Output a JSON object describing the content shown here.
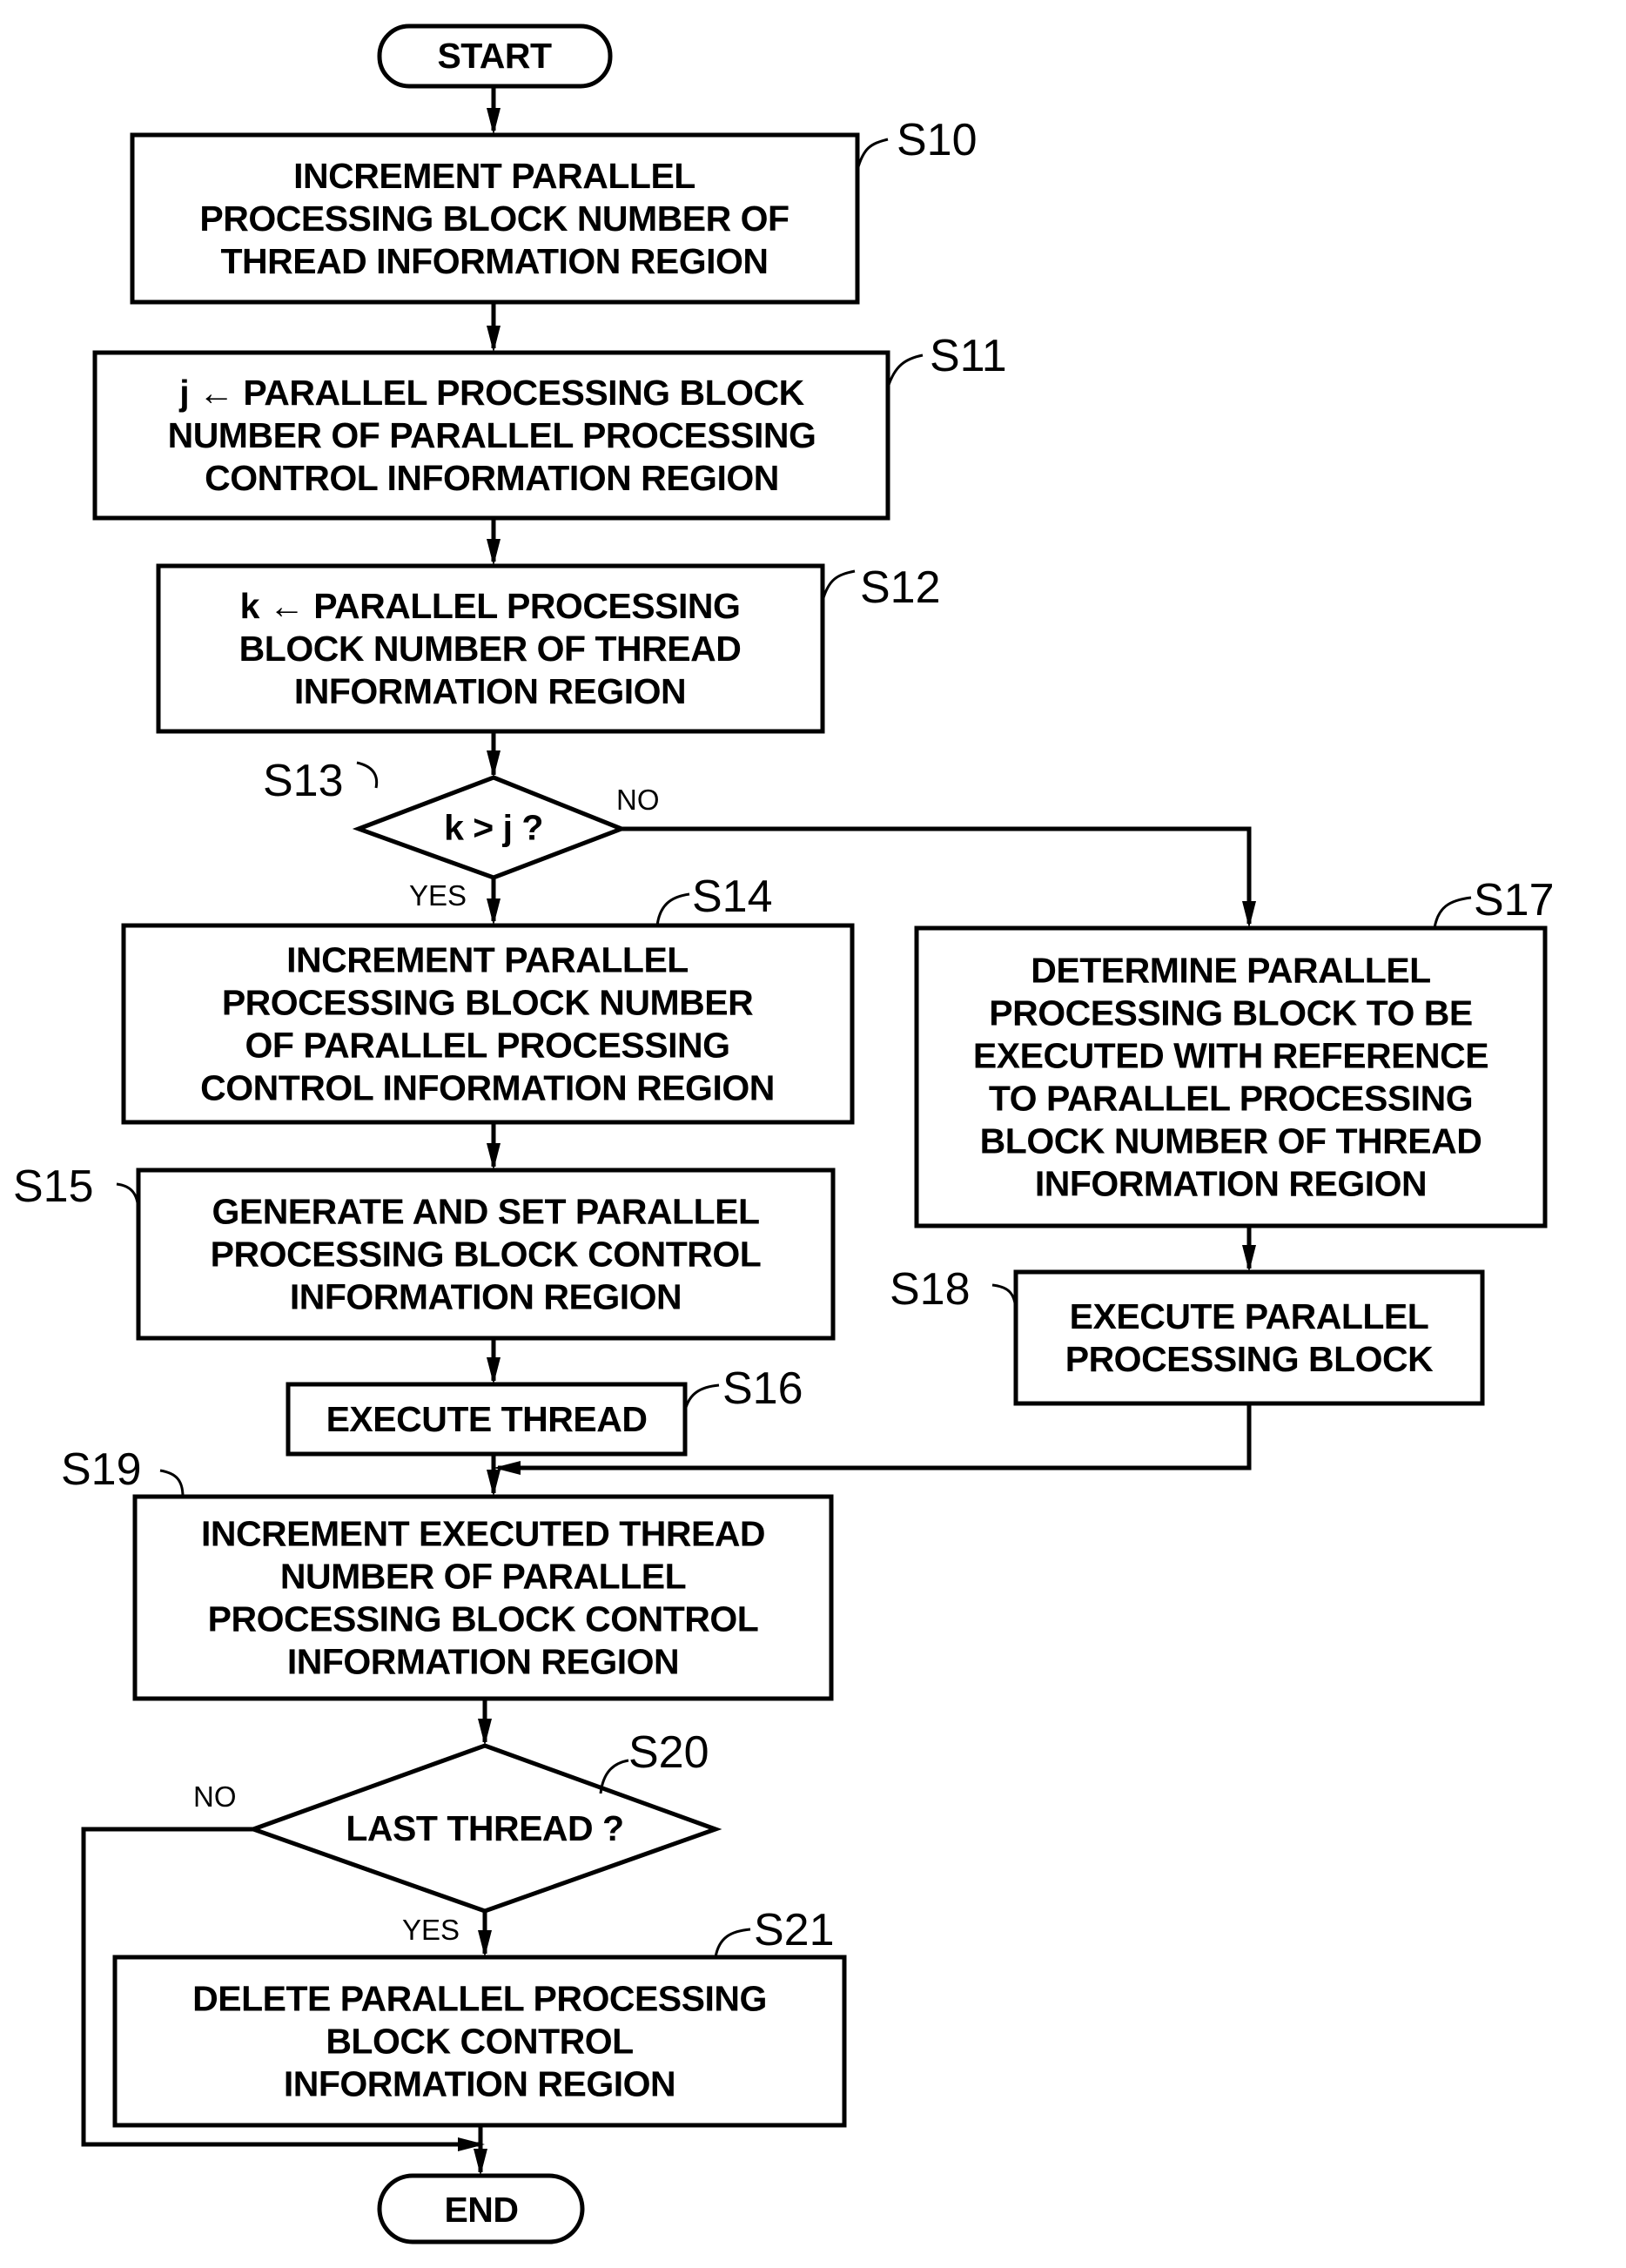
{
  "figure": {
    "terminals": {
      "start": "START",
      "end": "END"
    },
    "steps": [
      {
        "id": "S10",
        "label": "S10",
        "lines": [
          "INCREMENT PARALLEL",
          "PROCESSING BLOCK NUMBER OF",
          "THREAD INFORMATION REGION"
        ]
      },
      {
        "id": "S11",
        "label": "S11",
        "lines": [
          "j ← PARALLEL PROCESSING BLOCK",
          "NUMBER OF PARALLEL PROCESSING",
          "CONTROL INFORMATION REGION"
        ]
      },
      {
        "id": "S12",
        "label": "S12",
        "lines": [
          "k ← PARALLEL PROCESSING",
          "BLOCK NUMBER OF THREAD",
          "INFORMATION REGION"
        ]
      },
      {
        "id": "S13",
        "label": "S13",
        "lines": [
          "k > j ?"
        ],
        "type": "decision",
        "yes": "YES",
        "no": "NO"
      },
      {
        "id": "S14",
        "label": "S14",
        "lines": [
          "INCREMENT PARALLEL",
          "PROCESSING BLOCK NUMBER",
          "OF PARALLEL PROCESSING",
          "CONTROL INFORMATION REGION"
        ]
      },
      {
        "id": "S15",
        "label": "S15",
        "lines": [
          "GENERATE AND SET PARALLEL",
          "PROCESSING BLOCK CONTROL",
          "INFORMATION REGION"
        ]
      },
      {
        "id": "S16",
        "label": "S16",
        "lines": [
          "EXECUTE THREAD"
        ]
      },
      {
        "id": "S17",
        "label": "S17",
        "lines": [
          "DETERMINE PARALLEL",
          "PROCESSING BLOCK TO BE",
          "EXECUTED WITH REFERENCE",
          "TO PARALLEL PROCESSING",
          "BLOCK NUMBER OF THREAD",
          "INFORMATION REGION"
        ]
      },
      {
        "id": "S18",
        "label": "S18",
        "lines": [
          "EXECUTE PARALLEL",
          "PROCESSING BLOCK"
        ]
      },
      {
        "id": "S19",
        "label": "S19",
        "lines": [
          "INCREMENT EXECUTED THREAD",
          "NUMBER OF PARALLEL",
          "PROCESSING BLOCK CONTROL",
          "INFORMATION REGION"
        ]
      },
      {
        "id": "S20",
        "label": "S20",
        "lines": [
          "LAST THREAD ?"
        ],
        "type": "decision",
        "yes": "YES",
        "no": "NO"
      },
      {
        "id": "S21",
        "label": "S21",
        "lines": [
          "DELETE PARALLEL PROCESSING",
          "BLOCK CONTROL",
          "INFORMATION REGION"
        ]
      }
    ]
  }
}
